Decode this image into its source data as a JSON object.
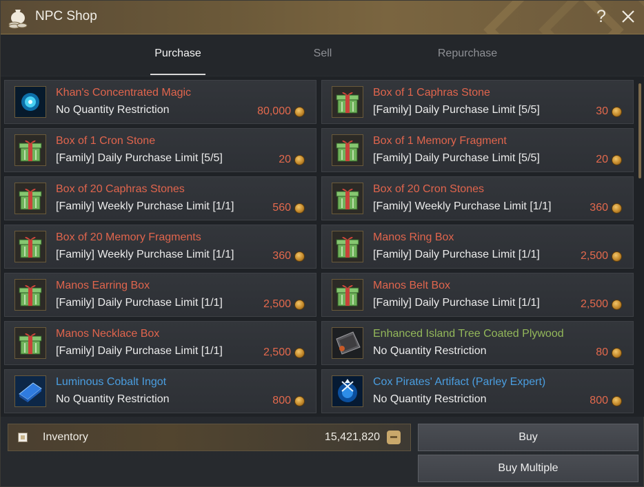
{
  "window": {
    "title": "NPC Shop",
    "help_label": "?"
  },
  "tabs": [
    {
      "label": "Purchase",
      "active": true
    },
    {
      "label": "Sell",
      "active": false
    },
    {
      "label": "Repurchase",
      "active": false
    }
  ],
  "items": [
    {
      "name": "Khan's Concentrated Magic",
      "limit": "No Quantity Restriction",
      "price": "80,000",
      "name_color": "#e1654d",
      "icon": "blue-magic-orb-icon"
    },
    {
      "name": "Box of 1 Caphras Stone",
      "limit": "[Family] Daily Purchase Limit [5/5]",
      "price": "30",
      "name_color": "#e1654d",
      "icon": "gift-box-icon"
    },
    {
      "name": "Box of 1 Cron Stone",
      "limit": "[Family] Daily Purchase Limit [5/5]",
      "price": "20",
      "name_color": "#e1654d",
      "icon": "gift-box-icon"
    },
    {
      "name": "Box of 1 Memory Fragment",
      "limit": "[Family] Daily Purchase Limit [5/5]",
      "price": "20",
      "name_color": "#e1654d",
      "icon": "gift-box-icon"
    },
    {
      "name": "Box of 20 Caphras Stones",
      "limit": "[Family] Weekly Purchase Limit [1/1]",
      "price": "560",
      "name_color": "#e1654d",
      "icon": "gift-box-icon"
    },
    {
      "name": "Box of 20 Cron Stones",
      "limit": "[Family] Weekly Purchase Limit [1/1]",
      "price": "360",
      "name_color": "#e1654d",
      "icon": "gift-box-icon"
    },
    {
      "name": "Box of 20 Memory Fragments",
      "limit": "[Family] Weekly Purchase Limit [1/1]",
      "price": "360",
      "name_color": "#e1654d",
      "icon": "gift-box-icon"
    },
    {
      "name": "Manos Ring Box",
      "limit": "[Family] Daily Purchase Limit [1/1]",
      "price": "2,500",
      "name_color": "#e1654d",
      "icon": "gift-box-icon"
    },
    {
      "name": "Manos Earring Box",
      "limit": "[Family] Daily Purchase Limit [1/1]",
      "price": "2,500",
      "name_color": "#e1654d",
      "icon": "gift-box-icon"
    },
    {
      "name": "Manos Belt Box",
      "limit": "[Family] Daily Purchase Limit [1/1]",
      "price": "2,500",
      "name_color": "#e1654d",
      "icon": "gift-box-icon"
    },
    {
      "name": "Manos Necklace Box",
      "limit": "[Family] Daily Purchase Limit [1/1]",
      "price": "2,500",
      "name_color": "#e1654d",
      "icon": "gift-box-icon"
    },
    {
      "name": "Enhanced Island Tree Coated Plywood",
      "limit": "No Quantity Restriction",
      "price": "80",
      "name_color": "#93b85a",
      "icon": "plywood-icon"
    },
    {
      "name": "Luminous Cobalt Ingot",
      "limit": "No Quantity Restriction",
      "price": "800",
      "name_color": "#4a9ee0",
      "icon": "cobalt-ingot-icon"
    },
    {
      "name": "Cox Pirates' Artifact (Parley Expert)",
      "limit": "No Quantity Restriction",
      "price": "800",
      "name_color": "#4a9ee0",
      "icon": "pirate-artifact-icon"
    }
  ],
  "inventory": {
    "label": "Inventory",
    "amount": "15,421,820"
  },
  "buttons": {
    "buy": "Buy",
    "buy_multiple": "Buy Multiple"
  },
  "colors": {
    "price": "#e4694d",
    "accent_gold": "#8b7446"
  }
}
